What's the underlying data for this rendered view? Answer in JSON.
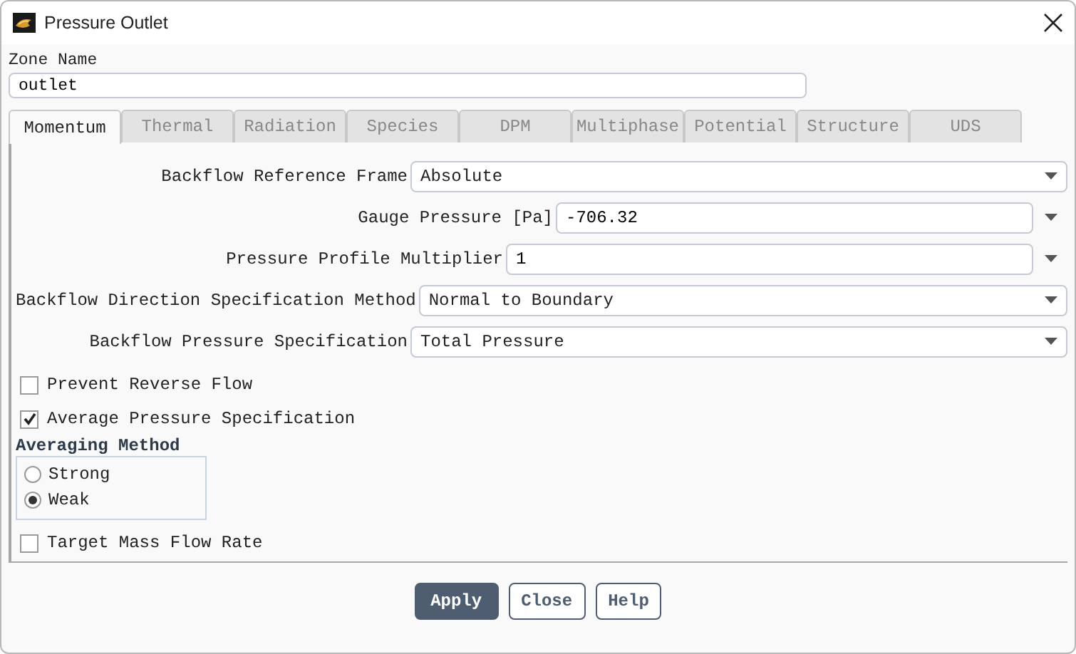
{
  "window": {
    "title": "Pressure Outlet"
  },
  "zone_name": {
    "label": "Zone Name",
    "value": "outlet"
  },
  "tabs": [
    {
      "label": "Momentum",
      "selected": true
    },
    {
      "label": "Thermal",
      "selected": false
    },
    {
      "label": "Radiation",
      "selected": false
    },
    {
      "label": "Species",
      "selected": false
    },
    {
      "label": "DPM",
      "selected": false
    },
    {
      "label": "Multiphase",
      "selected": false
    },
    {
      "label": "Potential",
      "selected": false
    },
    {
      "label": "Structure",
      "selected": false
    },
    {
      "label": "UDS",
      "selected": false
    }
  ],
  "fields": [
    {
      "kind": "dropdown",
      "label": "Backflow Reference Frame",
      "value": "Absolute"
    },
    {
      "kind": "number",
      "label": "Gauge Pressure [Pa]",
      "value": "-706.32"
    },
    {
      "kind": "number",
      "label": "Pressure Profile Multiplier",
      "value": "1"
    },
    {
      "kind": "dropdown",
      "label": "Backflow Direction Specification Method",
      "value": "Normal to Boundary"
    },
    {
      "kind": "dropdown",
      "label": "Backflow Pressure Specification",
      "value": "Total Pressure"
    }
  ],
  "options_top": [
    {
      "label": "Prevent Reverse Flow",
      "checked": false
    },
    {
      "label": "Average Pressure Specification",
      "checked": true
    }
  ],
  "averaging_method": {
    "title": "Averaging Method",
    "options": [
      {
        "label": "Strong",
        "selected": false
      },
      {
        "label": "Weak",
        "selected": true
      }
    ]
  },
  "options_bottom": [
    {
      "label": "Target Mass Flow Rate",
      "checked": false
    }
  ],
  "buttons": [
    {
      "label": "Apply",
      "kind": "primary"
    },
    {
      "label": "Close",
      "kind": "secondary"
    },
    {
      "label": "Help",
      "kind": "secondary"
    }
  ]
}
